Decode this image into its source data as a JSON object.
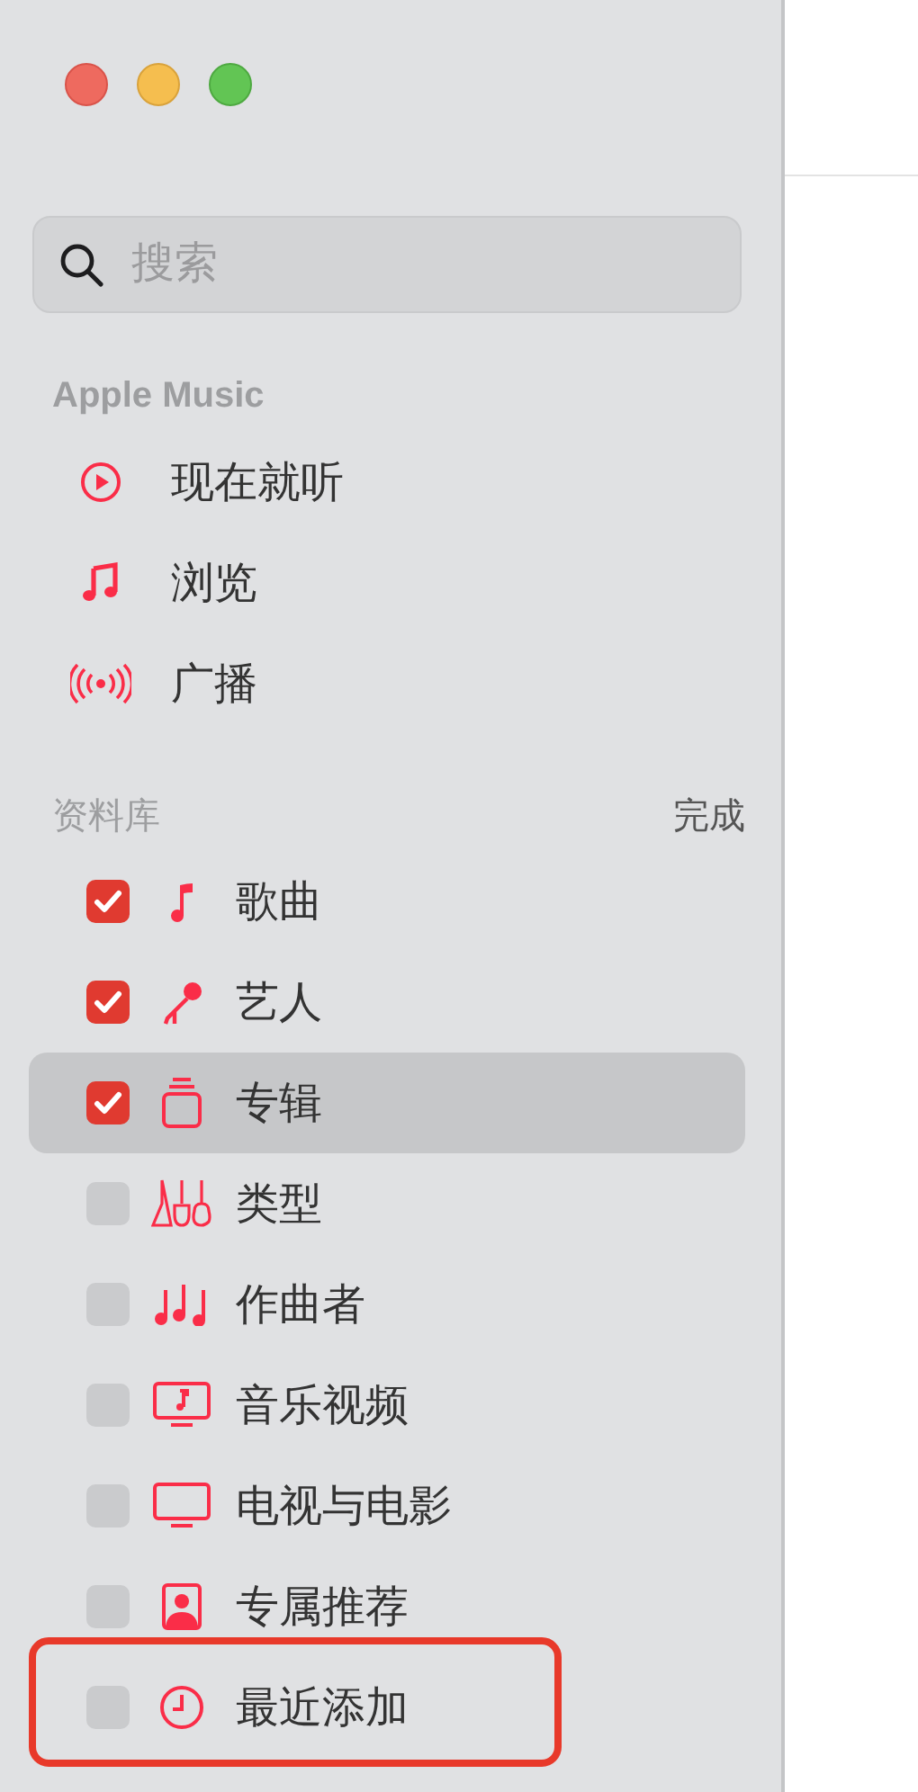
{
  "search": {
    "placeholder": "搜索"
  },
  "apple_music": {
    "heading": "Apple Music",
    "items": [
      {
        "label": "现在就听"
      },
      {
        "label": "浏览"
      },
      {
        "label": "广播"
      }
    ]
  },
  "library": {
    "heading": "资料库",
    "done_button": "完成",
    "items": [
      {
        "label": "歌曲",
        "checked": true,
        "selected": false,
        "highlighted": false
      },
      {
        "label": "艺人",
        "checked": true,
        "selected": false,
        "highlighted": false
      },
      {
        "label": "专辑",
        "checked": true,
        "selected": true,
        "highlighted": false
      },
      {
        "label": "类型",
        "checked": false,
        "selected": false,
        "highlighted": false
      },
      {
        "label": "作曲者",
        "checked": false,
        "selected": false,
        "highlighted": false
      },
      {
        "label": "音乐视频",
        "checked": false,
        "selected": false,
        "highlighted": false
      },
      {
        "label": "电视与电影",
        "checked": false,
        "selected": false,
        "highlighted": false
      },
      {
        "label": "专属推荐",
        "checked": false,
        "selected": false,
        "highlighted": false
      },
      {
        "label": "最近添加",
        "checked": false,
        "selected": false,
        "highlighted": true
      }
    ]
  }
}
